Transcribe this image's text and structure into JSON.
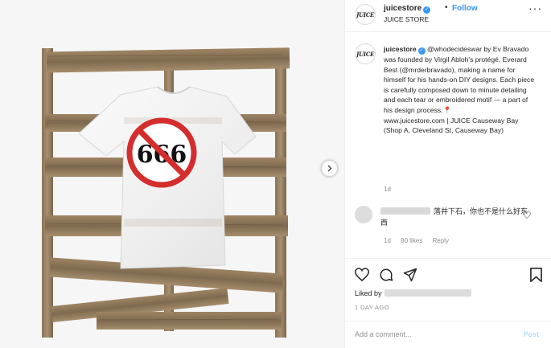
{
  "post": {
    "image_alt": "White t-shirt with a crossed-out 666 print hung on a wooden pallet",
    "print_text": "666"
  },
  "header": {
    "username": "juicestore",
    "verified_icon": "verified-badge-icon",
    "separator": "•",
    "follow_label": "Follow",
    "display_name": "JUICE STORE",
    "more_icon": "more-options-icon",
    "avatar_text": "JUICE"
  },
  "caption": {
    "username": "juicestore",
    "text": "@whodecideswar by Ev Bravado was founded by Virgil Abloh's protégé, Everard Best (@mrderbravado), making a name for himself for his hands-on DIY designs. Each piece is carefully composed down to minute detailing and each tear or embroidered motif — a part of his design process.",
    "pin_icon": "📍",
    "location": "www.juicestore.com | JUICE Causeway Bay (Shop A, Cleveland St, Causeway Bay)",
    "age": "1d"
  },
  "comment": {
    "text": "落井下石，你也不是什么好东西",
    "age": "1d",
    "likes": "80 likes",
    "reply": "Reply"
  },
  "footer": {
    "liked_by_label": "Liked by",
    "date": "1 DAY AGO",
    "add_comment_placeholder": "Add a comment...",
    "post_label": "Post"
  },
  "colors": {
    "accent": "#3897f0",
    "text": "#262626",
    "muted": "#8e8e8e",
    "prohibition_red": "#d42d2d"
  }
}
